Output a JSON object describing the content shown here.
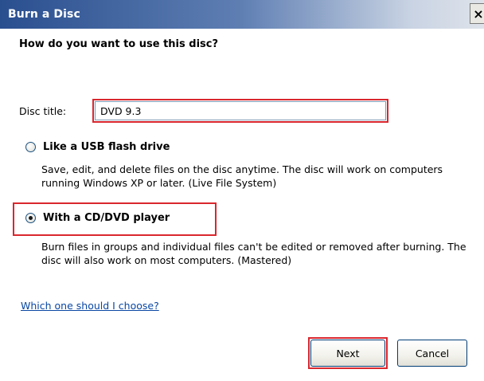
{
  "window": {
    "title": "Burn a Disc",
    "close_label": "×"
  },
  "form": {
    "heading": "How do you want to use this disc?",
    "disc_title_label": "Disc title:",
    "disc_title_value": "DVD 9.3"
  },
  "options": [
    {
      "label": "Like a USB flash drive",
      "description": "Save, edit, and delete files on the disc anytime. The disc will work on computers running Windows XP or later. (Live File System)",
      "selected": false
    },
    {
      "label": "With a CD/DVD player",
      "description": "Burn files in groups and individual files can't be edited or removed after burning. The disc will also work on most computers. (Mastered)",
      "selected": true
    }
  ],
  "help_link": "Which one should I choose?",
  "buttons": {
    "next": "Next",
    "cancel": "Cancel"
  },
  "colors": {
    "titlebar_start": "#2a4f8f",
    "highlight_border": "#d9272e",
    "link": "#0a47a3"
  }
}
